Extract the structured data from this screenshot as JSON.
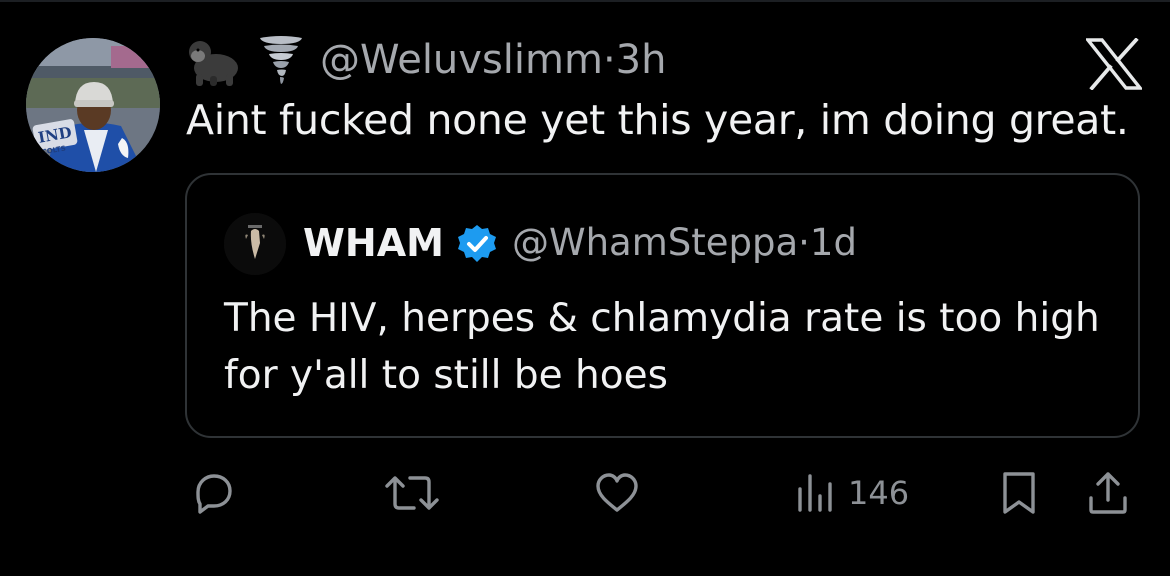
{
  "tweet": {
    "author_emojis": [
      "gorilla-emoji",
      "tornado-emoji"
    ],
    "handle": "@Weluvslimm",
    "time_separator": "·",
    "time": "3h",
    "text": "Aint fucked none yet this year, im doing great.",
    "avatar_text": "IND COLTS"
  },
  "quoted_tweet": {
    "name": "WHAM",
    "verified": true,
    "handle": "@WhamSteppa",
    "time_separator": "·",
    "time": "1d",
    "text": "The HIV, herpes & chlamydia rate is too high for y'all to still be hoes"
  },
  "actions": {
    "views": "146"
  },
  "colors": {
    "background": "#000000",
    "text": "#f1f2f3",
    "muted": "#a5a8ad",
    "border": "#2f3336",
    "verified": "#1d9bf0",
    "icon": "#8d9196"
  }
}
